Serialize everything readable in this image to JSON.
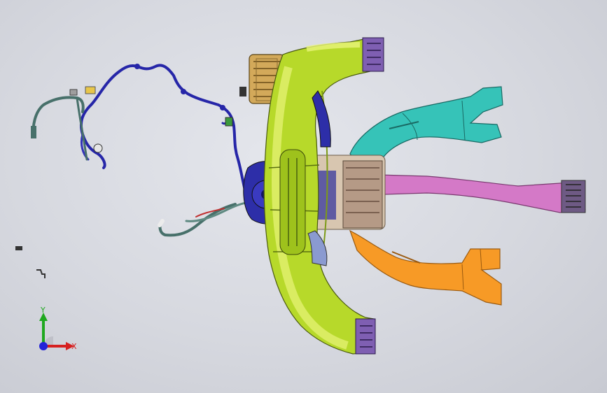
{
  "viewport": {
    "background": "#d8dae0"
  },
  "model": {
    "parts": [
      {
        "id": "main-duct",
        "color": "#b7d92a"
      },
      {
        "id": "duct-highlight",
        "color": "#e8f47a"
      },
      {
        "id": "cyan-duct",
        "color": "#36c3b8"
      },
      {
        "id": "pink-duct",
        "color": "#d479c7"
      },
      {
        "id": "orange-duct",
        "color": "#f79a26"
      },
      {
        "id": "blower",
        "color": "#2d2ea8"
      },
      {
        "id": "heater-core",
        "color": "#d3a95a"
      },
      {
        "id": "wire-harness",
        "color": "#2626a8"
      },
      {
        "id": "hose",
        "color": "#47706a"
      },
      {
        "id": "actuator",
        "color": "#7f5fb2"
      }
    ]
  },
  "triad": {
    "x_label": "X",
    "y_label": "Y",
    "x_color": "#d62020",
    "y_color": "#1fa81f",
    "z_color": "#2424d8"
  }
}
